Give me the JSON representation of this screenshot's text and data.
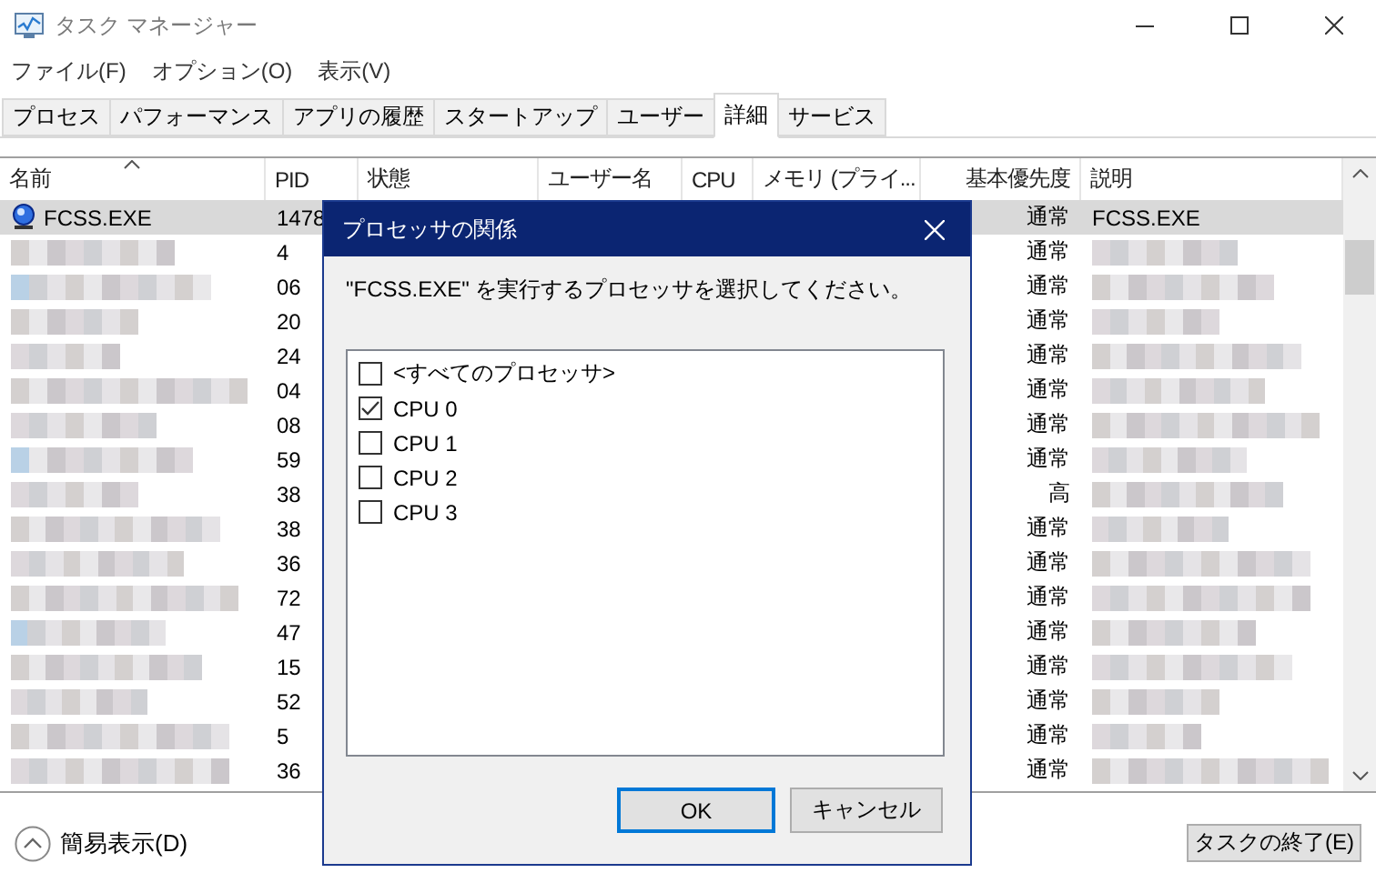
{
  "window": {
    "title": "タスク マネージャー"
  },
  "menu": [
    "ファイル(F)",
    "オプション(O)",
    "表示(V)"
  ],
  "tabs": [
    {
      "label": "プロセス",
      "selected": false
    },
    {
      "label": "パフォーマンス",
      "selected": false
    },
    {
      "label": "アプリの履歴",
      "selected": false
    },
    {
      "label": "スタートアップ",
      "selected": false
    },
    {
      "label": "ユーザー",
      "selected": false
    },
    {
      "label": "詳細",
      "selected": true
    },
    {
      "label": "サービス",
      "selected": false
    }
  ],
  "table": {
    "columns": [
      "名前",
      "PID",
      "状態",
      "ユーザー名",
      "CPU",
      "メモリ (プライ...",
      "基本優先度",
      "説明"
    ],
    "rows": [
      {
        "name": "FCSS.EXE",
        "pid": "1478",
        "priority": "通常",
        "description": "FCSS.EXE",
        "selected": true
      },
      {
        "pid": "4",
        "priority": "通常",
        "selected": false
      },
      {
        "pid": "06",
        "priority": "通常",
        "selected": false
      },
      {
        "pid": "20",
        "priority": "通常",
        "selected": false
      },
      {
        "pid": "24",
        "priority": "通常",
        "selected": false
      },
      {
        "pid": "04",
        "priority": "通常",
        "selected": false
      },
      {
        "pid": "08",
        "priority": "通常",
        "selected": false
      },
      {
        "pid": "59",
        "priority": "通常",
        "selected": false
      },
      {
        "pid": "38",
        "priority": "高",
        "selected": false
      },
      {
        "pid": "38",
        "priority": "通常",
        "selected": false
      },
      {
        "pid": "36",
        "priority": "通常",
        "selected": false
      },
      {
        "pid": "72",
        "priority": "通常",
        "selected": false
      },
      {
        "pid": "47",
        "priority": "通常",
        "selected": false
      },
      {
        "pid": "15",
        "priority": "通常",
        "selected": false
      },
      {
        "pid": "52",
        "priority": "通常",
        "selected": false
      },
      {
        "pid": "5",
        "priority": "通常",
        "selected": false
      },
      {
        "pid": "36",
        "priority": "通常",
        "selected": false
      }
    ]
  },
  "footer": {
    "fewer_details": "簡易表示(D)",
    "end_task": "タスクの終了(E)"
  },
  "dialog": {
    "title": "プロセッサの関係",
    "prompt": "\"FCSS.EXE\" を実行するプロセッサを選択してください。",
    "items": [
      {
        "label": "<すべてのプロセッサ>",
        "checked": false
      },
      {
        "label": "CPU 0",
        "checked": true
      },
      {
        "label": "CPU 1",
        "checked": false
      },
      {
        "label": "CPU 2",
        "checked": false
      },
      {
        "label": "CPU 3",
        "checked": false
      }
    ],
    "buttons": [
      "OK",
      "キャンセル"
    ]
  }
}
